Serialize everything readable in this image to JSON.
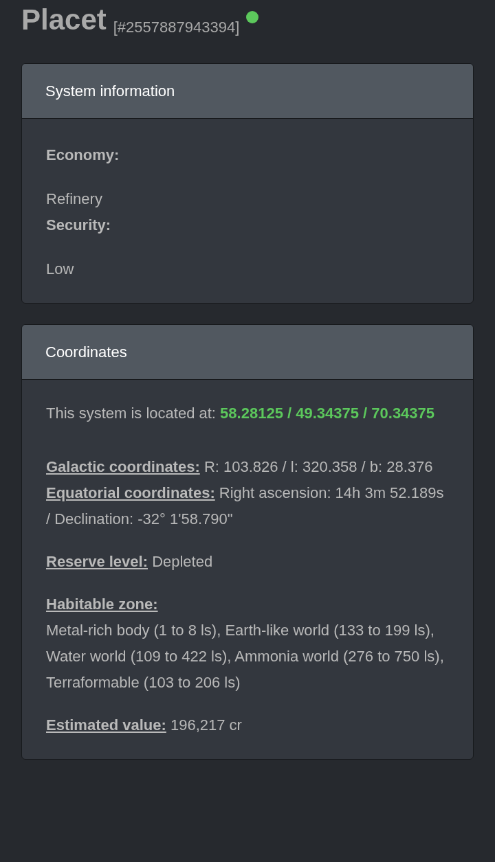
{
  "header": {
    "title": "Placet",
    "system_id": "[#2557887943394]",
    "online": true
  },
  "system_information": {
    "title": "System information",
    "fields": [
      {
        "label": "Economy:",
        "value": "Refinery"
      },
      {
        "label": "Security:",
        "value": "Low"
      }
    ]
  },
  "coordinates": {
    "title": "Coordinates",
    "location": {
      "text": "This system is located at:",
      "highlight": "58.28125 / 49.34375 / 70.34375"
    },
    "sections": [
      {
        "items": [
          {
            "kind": "inline",
            "label": "Galactic coordinates:",
            "value": "R: 103.826 / l: 320.358 / b: 28.376"
          },
          {
            "kind": "inline",
            "label": "Equatorial coordinates:",
            "value": "Right ascension: 14h 3m 52.189s / Declination: -32° 1'58.790\""
          }
        ]
      },
      {
        "items": [
          {
            "kind": "inline",
            "label": "Reserve level:",
            "value": "Depleted"
          }
        ]
      },
      {
        "items": [
          {
            "kind": "block",
            "label": "Habitable zone:",
            "value": "Metal-rich body (1 to 8 ls), Earth-like world (133 to 199 ls), Water world (109 to 422 ls), Ammonia world (276 to 750 ls), Terraformable (103 to 206 ls)"
          }
        ]
      },
      {
        "items": [
          {
            "kind": "inline",
            "label": "Estimated value:",
            "value": "196,217 cr"
          }
        ]
      }
    ]
  }
}
